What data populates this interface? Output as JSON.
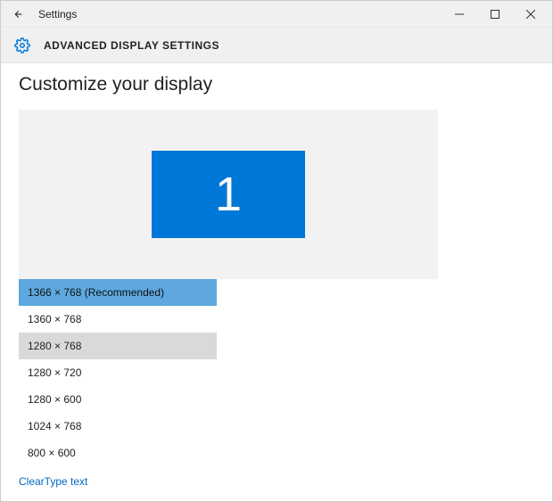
{
  "window": {
    "title": "Settings"
  },
  "header": {
    "title": "ADVANCED DISPLAY SETTINGS",
    "icon": "gear-icon"
  },
  "page": {
    "title": "Customize your display"
  },
  "display_preview": {
    "monitor_label": "1"
  },
  "resolution_options": [
    {
      "label": "1366 × 768 (Recommended)",
      "state": "selected"
    },
    {
      "label": "1360 × 768",
      "state": "normal"
    },
    {
      "label": "1280 × 768",
      "state": "hovered"
    },
    {
      "label": "1280 × 720",
      "state": "normal"
    },
    {
      "label": "1280 × 600",
      "state": "normal"
    },
    {
      "label": "1024 × 768",
      "state": "normal"
    },
    {
      "label": "800 × 600",
      "state": "normal"
    }
  ],
  "links": {
    "cleartype": "ClearType text"
  }
}
